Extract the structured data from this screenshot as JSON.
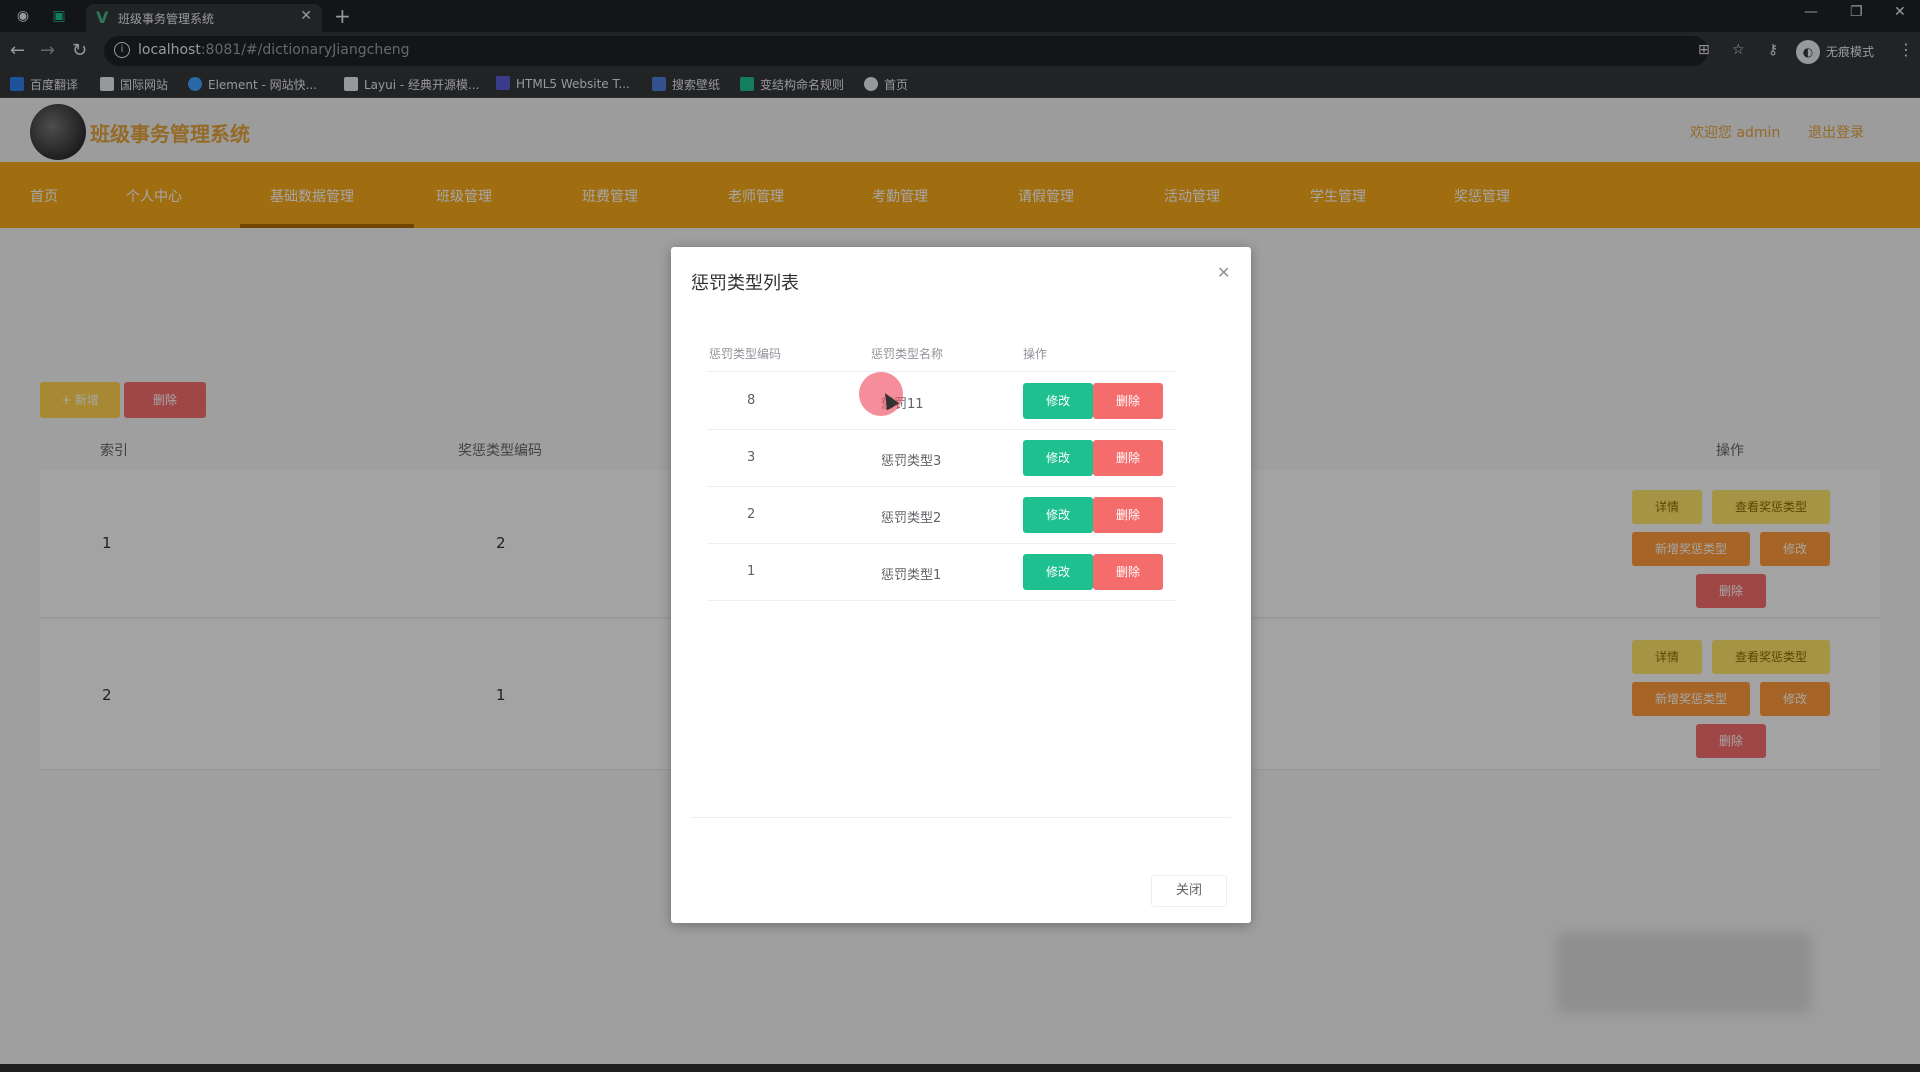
{
  "browser": {
    "tab_title": "班级事务管理系统",
    "url_host": "localhost",
    "url_rest": ":8081/#/dictionaryJiangcheng",
    "incognito_label": "无痕模式",
    "bookmarks": [
      "百度翻译",
      "国际网站",
      "Element - 网站快...",
      "Layui - 经典开源模...",
      "HTML5 Website T...",
      "搜索壁纸",
      "变结构命名规则",
      "首页"
    ]
  },
  "site": {
    "title": "班级事务管理系统",
    "welcome": "欢迎您 admin",
    "logout": "退出登录",
    "nav": [
      "首页",
      "个人中心",
      "基础数据管理",
      "班级管理",
      "班费管理",
      "老师管理",
      "考勤管理",
      "请假管理",
      "活动管理",
      "学生管理",
      "奖惩管理"
    ]
  },
  "toolbar": {
    "add_label": "+ 新增",
    "delete_label": "删除"
  },
  "table": {
    "headers": [
      "索引",
      "奖惩类型编码",
      "",
      "操作"
    ],
    "rows": [
      {
        "index": "1",
        "code": "2"
      },
      {
        "index": "2",
        "code": "1"
      }
    ],
    "actions": {
      "detail": "详情",
      "view": "查看奖惩类型",
      "add": "新增奖惩类型",
      "edit": "修改",
      "delete": "删除"
    }
  },
  "dialog": {
    "title": "惩罚类型列表",
    "headers": [
      "惩罚类型编码",
      "惩罚类型名称",
      "操作"
    ],
    "rows": [
      {
        "code": "8",
        "name": "惩罚11"
      },
      {
        "code": "3",
        "name": "惩罚类型3"
      },
      {
        "code": "2",
        "name": "惩罚类型2"
      },
      {
        "code": "1",
        "name": "惩罚类型1"
      }
    ],
    "edit_label": "修改",
    "delete_label": "删除",
    "close_label": "关闭"
  },
  "colors": {
    "nav_orange": "#f6a91a",
    "edit_green": "#1fc08f",
    "delete_red": "#f56c6c"
  }
}
